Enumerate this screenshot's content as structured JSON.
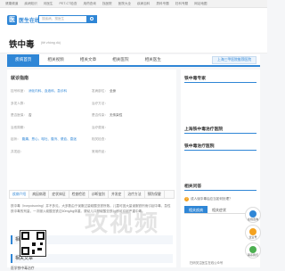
{
  "topnav": {
    "items": [
      "健康频道",
      "疾病知识",
      "问医生",
      "PET-CT检查",
      "用药查询",
      "找医院",
      "医院大全",
      "疾病百科",
      "男科专题",
      "妇科专题",
      "网站地图"
    ]
  },
  "header": {
    "logo_text": "医生在线",
    "logo_mark": "医",
    "search_placeholder": "搜疾病、搜医生",
    "search_icon": "magnifier-icon"
  },
  "page": {
    "title": "铁中毒",
    "pinyin": "(tiě zhòng dú)"
  },
  "tabs": {
    "items": [
      "疾病首页",
      "相关视频",
      "相关文章",
      "相关医院",
      "相关医生"
    ],
    "active": "疾病首页",
    "cta": "上海三甲医院推荐医院"
  },
  "main": {
    "section_title": "就诊指南",
    "info": [
      [
        {
          "k": "挂号科室：",
          "v": "消化内科、血液科、急诊科",
          "link": true
        },
        {
          "k": "发病部位：",
          "v": "全身",
          "link": false
        }
      ],
      [
        {
          "k": "多发人群：",
          "v": "",
          "link": false
        },
        {
          "k": "治疗方法：",
          "v": "",
          "link": false
        }
      ],
      [
        {
          "k": "是否医保：",
          "v": "否",
          "link": false
        },
        {
          "k": "是否传染：",
          "v": "无传染性",
          "link": false
        }
      ],
      [
        {
          "k": "治愈周期：",
          "v": "",
          "link": false
        },
        {
          "k": "治疗费用：",
          "v": "",
          "link": false
        }
      ],
      [
        {
          "k": "症状：",
          "v": "腹痛、恶心、呕吐、腹泻、便血、昏迷",
          "link": true
        },
        {
          "k": "相关检查：",
          "v": "",
          "link": false
        }
      ],
      [
        {
          "k": "并发症：",
          "v": "",
          "link": false
        },
        {
          "k": "常用药品：",
          "v": "",
          "link": false
        }
      ],
      [
        {
          "k": "",
          "v": "",
          "link": false
        },
        {
          "k": "",
          "v": "",
          "link": false
        }
      ]
    ],
    "subtabs": [
      "疾病介绍",
      "病因病理",
      "症状体征",
      "检查检验",
      "诊断鉴别",
      "并发症",
      "治疗方法",
      "预防保健"
    ],
    "paragraph": "铁中毒（ironpoisoning）并不多见，大多数由于误服过量硫酸亚铁所致。儿童可因大量误服铁剂而引起中毒，急性铁中毒的剂量，一次服入硫酸亚铁达60mg/kg体重。婴幼儿口服硫酸亚铁1g即可引起严重中毒。",
    "box1": "相关视频",
    "box2": "相关文章",
    "article": "医学铁中毒治疗"
  },
  "side": {
    "expert_title": "铁中毒专家",
    "hospital_title": "上海铁中毒治疗医院",
    "hospital_title2": "铁中毒治疗医院",
    "qa_title": "相关问答",
    "qa_text": "成人误中毒后应当如何处理？",
    "rel_tabs": [
      "相关疾病",
      "相关症状"
    ],
    "qr_caption": "扫码关注医生在线公众号"
  },
  "floats": [
    {
      "label": "在线咨询",
      "color": "#2f86d6",
      "icon": "chat-icon"
    },
    {
      "label": "企业号",
      "color": "#f4a21f",
      "icon": "star-icon"
    },
    {
      "label": "联系我们",
      "color": "#4caf50",
      "icon": "phone-icon"
    }
  ],
  "watermark": "攻视频"
}
